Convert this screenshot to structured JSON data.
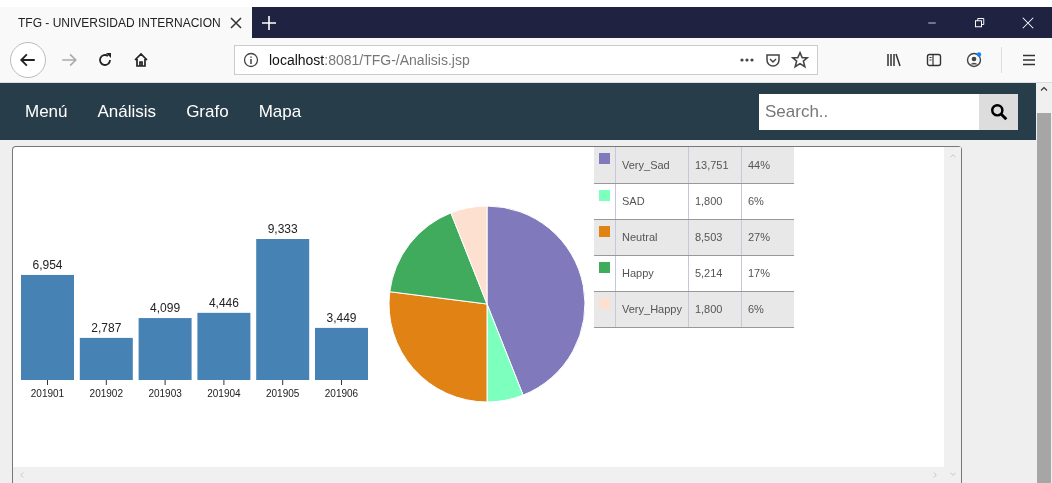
{
  "browser": {
    "tab": {
      "title": "TFG - UNIVERSIDAD INTERNACION"
    },
    "url": {
      "host": "localhost",
      "path": ":8081/TFG-/Analisis.jsp"
    }
  },
  "navbar": {
    "links": [
      {
        "label": "Menú"
      },
      {
        "label": "Análisis"
      },
      {
        "label": "Grafo"
      },
      {
        "label": "Mapa"
      }
    ],
    "search": {
      "placeholder": "Search.."
    }
  },
  "bar_chart": {
    "chart_data": {
      "type": "bar",
      "categories": [
        "201901",
        "201902",
        "201903",
        "201904",
        "201905",
        "201906"
      ],
      "values": [
        6954,
        2787,
        4099,
        4446,
        9333,
        3449
      ],
      "value_labels": [
        "6,954",
        "2,787",
        "4,099",
        "4,446",
        "9,333",
        "3,449"
      ],
      "data_labels": true
    }
  },
  "pie_chart": {
    "chart_data": {
      "type": "pie",
      "categories": [
        "Very_Sad",
        "SAD",
        "Neutral",
        "Happy",
        "Very_Happy"
      ],
      "values": [
        44,
        6,
        27,
        17,
        6
      ]
    },
    "legend": {
      "rows": [
        {
          "count": "13,751",
          "percent": "44%",
          "color": "#8079bb"
        },
        {
          "count": "1,800",
          "percent": "6%",
          "color": "#7dffbe"
        },
        {
          "count": "8,503",
          "percent": "27%",
          "color": "#e08214"
        },
        {
          "count": "5,214",
          "percent": "17%",
          "color": "#41ab5d"
        },
        {
          "count": "1,800",
          "percent": "6%",
          "color": "#fde0cf"
        }
      ]
    }
  }
}
